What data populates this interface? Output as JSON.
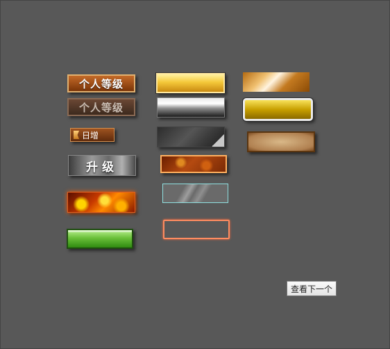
{
  "buttons": {
    "personal_level_active": "个人等级",
    "personal_level_dim": "个人等级",
    "daily_increase": "日增",
    "upgrade": "升级"
  },
  "navigation": {
    "view_next": "查看下一个"
  },
  "colors": {
    "canvas_background": "#585858",
    "green": "#6bc03a",
    "gold": "#f4c83a",
    "fire": "#ff8a00",
    "outline_orange": "#ff8c60",
    "glass_border": "#8fe0e0"
  },
  "icons": {
    "daily_flag": "flag-icon"
  }
}
